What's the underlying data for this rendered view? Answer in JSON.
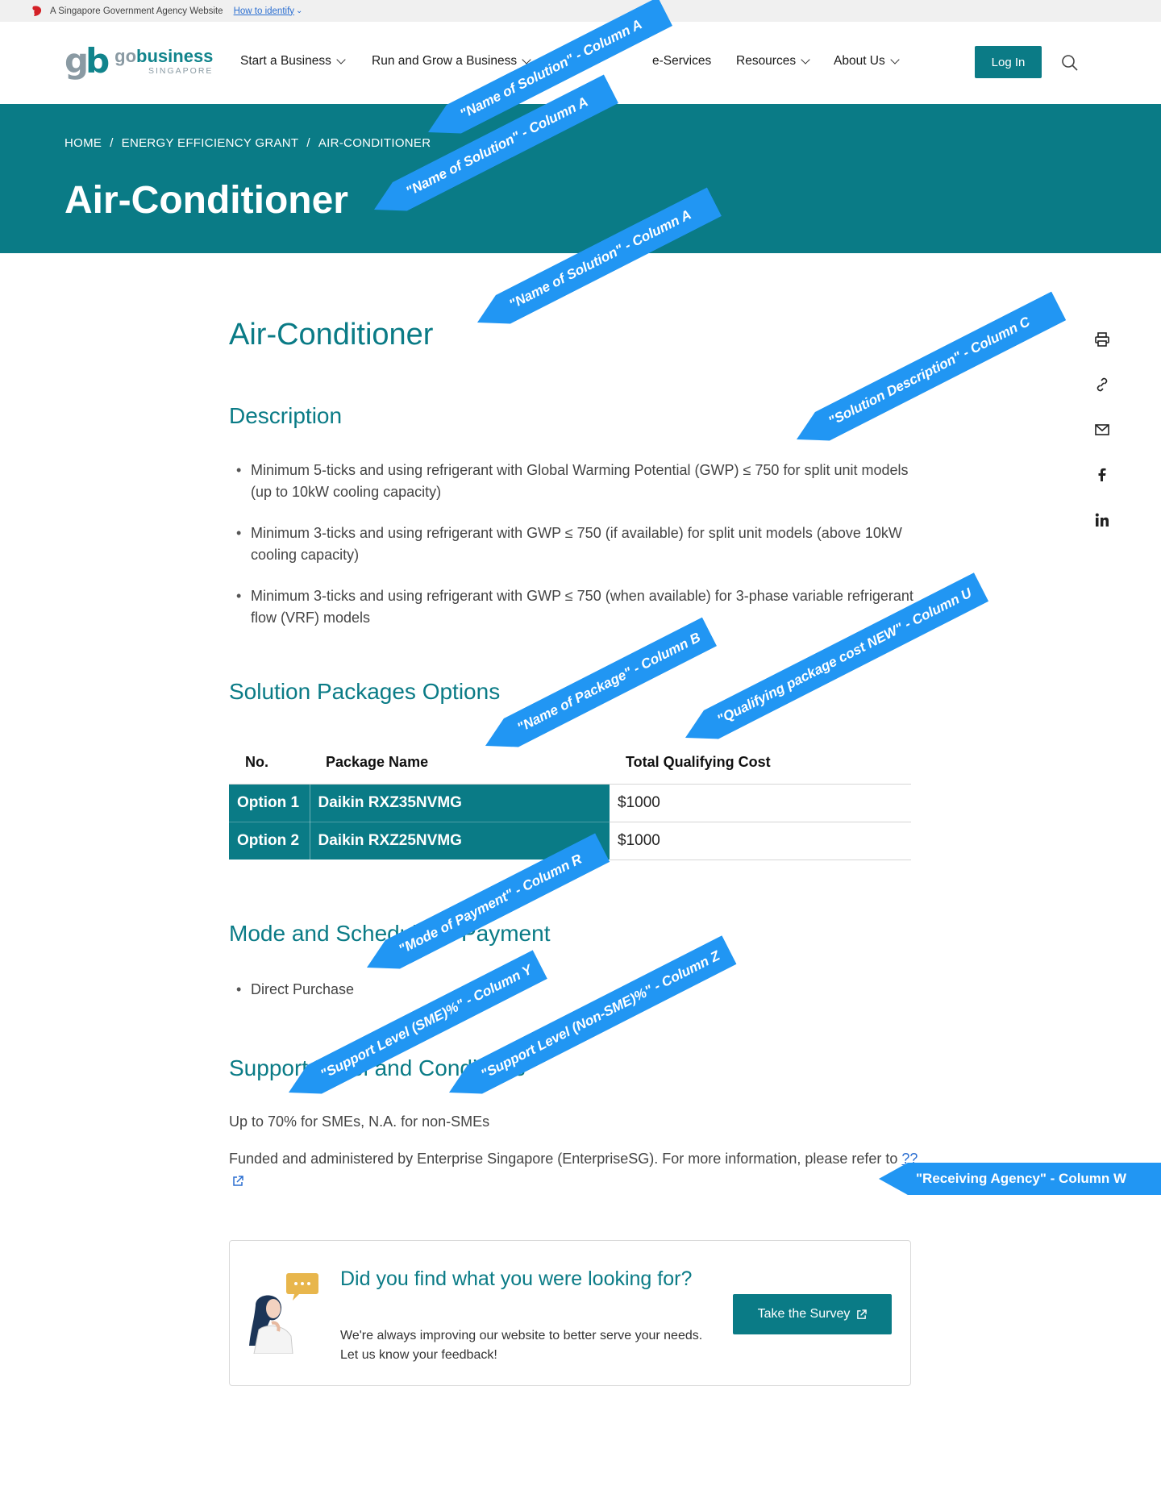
{
  "gov_banner": {
    "text": "A Singapore Government Agency Website",
    "identify_link": "How to identify"
  },
  "header": {
    "logo": {
      "mark_g": "g",
      "mark_b": "b",
      "word_go": "go",
      "word_business": "business",
      "subtitle": "SINGAPORE"
    },
    "nav": [
      {
        "label": "Start a Business",
        "has_dropdown": true
      },
      {
        "label": "Run and Grow a Business",
        "has_dropdown": true
      },
      {
        "label": "e-Services",
        "has_dropdown": false
      },
      {
        "label": "Resources",
        "has_dropdown": true
      },
      {
        "label": "About Us",
        "has_dropdown": true
      }
    ],
    "login_label": "Log In",
    "search_icon": "search-icon"
  },
  "breadcrumb": [
    "HOME",
    "/",
    "ENERGY EFFICIENCY GRANT",
    "/",
    "AIR-CONDITIONER"
  ],
  "hero_title": "Air-Conditioner",
  "page_heading": "Air-Conditioner",
  "description": {
    "heading": "Description",
    "items": [
      "Minimum 5-ticks and using refrigerant with Global Warming Potential (GWP) ≤ 750 for split unit models (up to 10kW cooling capacity)",
      "Minimum 3-ticks and using refrigerant with GWP ≤ 750 (if available) for split unit models (above 10kW cooling capacity)",
      "Minimum 3-ticks and using refrigerant with GWP ≤ 750 (when available) for 3-phase variable refrigerant flow (VRF) models"
    ]
  },
  "packages": {
    "heading": "Solution Packages Options",
    "columns": [
      "No.",
      "Package Name",
      "Total Qualifying Cost"
    ],
    "rows": [
      {
        "no": "Option 1",
        "name": "Daikin RXZ35NVMG",
        "cost": "$1000"
      },
      {
        "no": "Option 2",
        "name": "Daikin RXZ25NVMG",
        "cost": "$1000"
      }
    ]
  },
  "payment": {
    "heading": "Mode and Schedule of Payment",
    "items": [
      "Direct Purchase"
    ]
  },
  "support": {
    "heading": "Support Level and Conditions",
    "level_text": "Up to 70% for SMEs, N.A. for non-SMEs",
    "funding_text": "Funded and administered by Enterprise Singapore (EnterpriseSG). For more information, please refer to",
    "link_text": "??"
  },
  "survey": {
    "title": "Did you find what you were looking for?",
    "subtitle": "We're always improving our website to better serve your needs. Let us know your feedback!",
    "button_label": "Take the Survey"
  },
  "share_icons": [
    "print-icon",
    "link-icon",
    "mail-icon",
    "facebook-icon",
    "linkedin-icon"
  ],
  "callouts": [
    "\"Name of Solution\" - Column A",
    "\"Name of Solution\" - Column A",
    "\"Name of Solution\" - Column A",
    "\"Solution Description\" - Column C",
    "\"Name of Package\" - Column B",
    "\"Qualifying package cost NEW\" - Column U",
    "\"Mode of Payment\" - Column R",
    "\"Support Level (SME)%\" - Column Y",
    "\"Support Level (Non-SME)%\" - Column Z",
    "\"Receiving Agency\" - Column W"
  ],
  "colors": {
    "brand_teal": "#0a7b86",
    "callout_blue": "#2196f3",
    "link_blue": "#2c6fd1"
  }
}
